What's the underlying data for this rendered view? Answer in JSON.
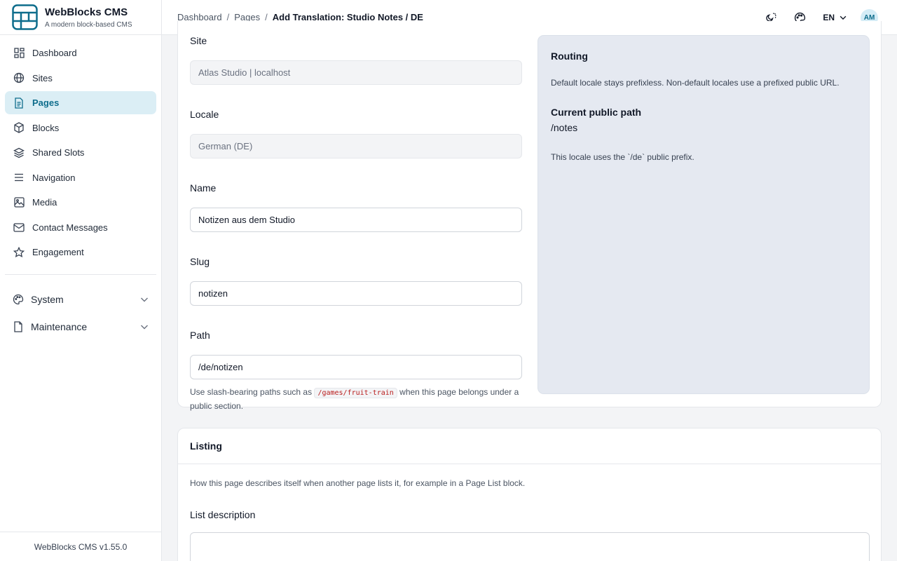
{
  "app": {
    "title": "WebBlocks CMS",
    "subtitle": "A modern block-based CMS",
    "version": "WebBlocks CMS v1.55.0",
    "accent": "#0e6d8c"
  },
  "sidebar": {
    "items": [
      {
        "label": "Dashboard",
        "icon": "grid-icon",
        "active": false
      },
      {
        "label": "Sites",
        "icon": "globe-icon",
        "active": false
      },
      {
        "label": "Pages",
        "icon": "document-icon",
        "active": true
      },
      {
        "label": "Blocks",
        "icon": "cube-icon",
        "active": false
      },
      {
        "label": "Shared Slots",
        "icon": "layers-icon",
        "active": false
      },
      {
        "label": "Navigation",
        "icon": "menu-icon",
        "active": false
      },
      {
        "label": "Media",
        "icon": "image-icon",
        "active": false
      },
      {
        "label": "Contact Messages",
        "icon": "mail-icon",
        "active": false
      },
      {
        "label": "Engagement",
        "icon": "star-icon",
        "active": false
      }
    ],
    "groups": [
      {
        "label": "System",
        "icon": "palette-icon"
      },
      {
        "label": "Maintenance",
        "icon": "file-icon"
      }
    ]
  },
  "header": {
    "breadcrumb": [
      "Dashboard",
      "Pages"
    ],
    "current": "Add Translation: Studio Notes / DE",
    "language": "EN",
    "avatar": "AM"
  },
  "form": {
    "site_label": "Site",
    "site_value": "Atlas Studio | localhost",
    "locale_label": "Locale",
    "locale_value": "German (DE)",
    "name_label": "Name",
    "name_value": "Notizen aus dem Studio",
    "slug_label": "Slug",
    "slug_value": "notizen",
    "path_label": "Path",
    "path_value": "/de/notizen",
    "path_hint_before": "Use slash-bearing paths such as",
    "path_hint_code": "/games/fruit-train",
    "path_hint_after": "when this page belongs under a public section."
  },
  "routing": {
    "title": "Routing",
    "description": "Default locale stays prefixless. Non-default locales use a prefixed public URL.",
    "current_label": "Current public path",
    "current_path": "/notes",
    "note": "This locale uses the `/de` public prefix."
  },
  "listing": {
    "title": "Listing",
    "description": "How this page describes itself when another page lists it, for example in a Page List block.",
    "list_description_label": "List description",
    "list_description_value": ""
  }
}
